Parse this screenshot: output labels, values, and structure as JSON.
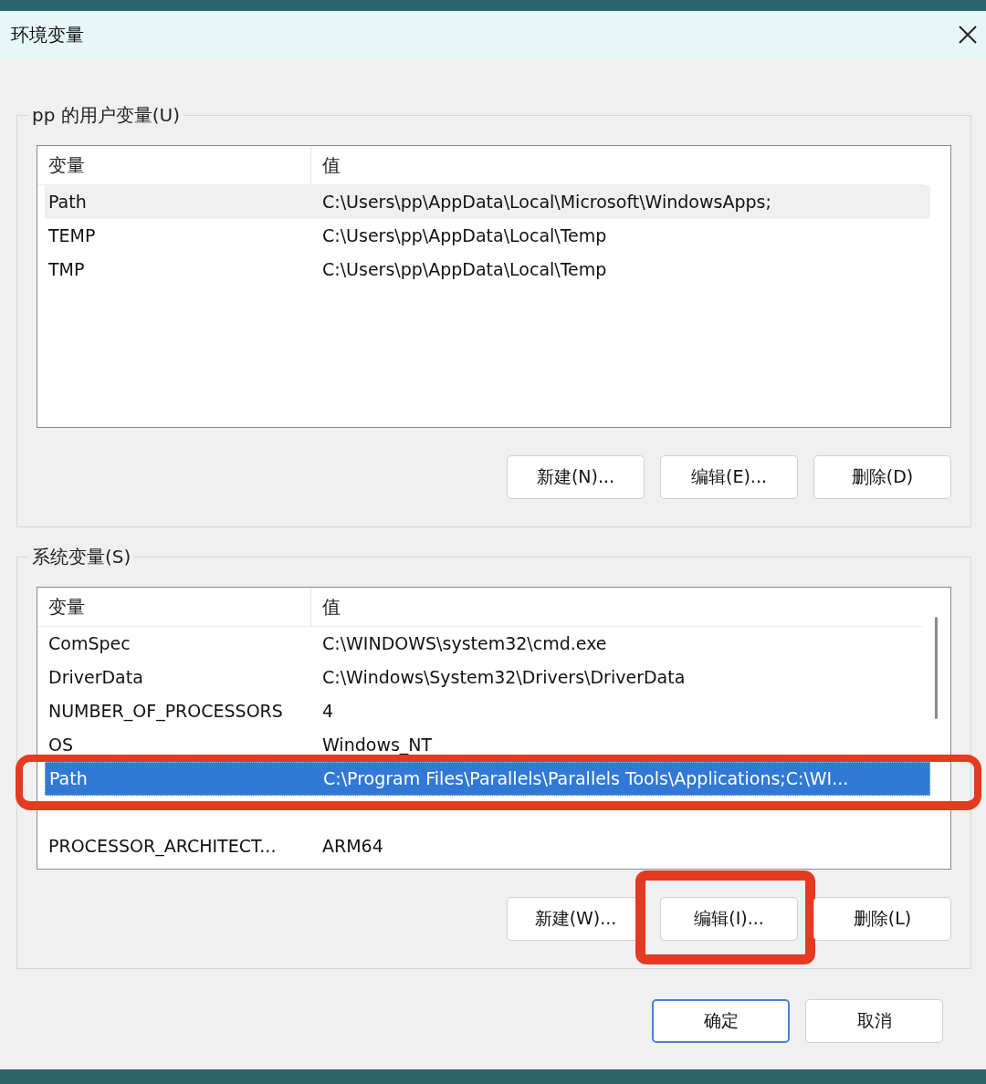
{
  "window": {
    "title": "环境变量"
  },
  "groups": [
    {
      "label": "pp 的用户变量(U)",
      "focused": false,
      "scrollbar": false,
      "columns": [
        "变量",
        "值"
      ],
      "rows": [
        {
          "name": "Path",
          "value": "C:\\Users\\pp\\AppData\\Local\\Microsoft\\WindowsApps;",
          "selected": true,
          "annotated": false
        },
        {
          "name": "TEMP",
          "value": "C:\\Users\\pp\\AppData\\Local\\Temp",
          "selected": false,
          "annotated": false
        },
        {
          "name": "TMP",
          "value": "C:\\Users\\pp\\AppData\\Local\\Temp",
          "selected": false,
          "annotated": false
        }
      ],
      "buttons": [
        {
          "label": "新建(N)...",
          "annotated": false
        },
        {
          "label": "编辑(E)...",
          "annotated": false
        },
        {
          "label": "删除(D)",
          "annotated": false
        }
      ]
    },
    {
      "label": "系统变量(S)",
      "focused": true,
      "scrollbar": true,
      "columns": [
        "变量",
        "值"
      ],
      "rows": [
        {
          "name": "ComSpec",
          "value": "C:\\WINDOWS\\system32\\cmd.exe",
          "selected": false,
          "annotated": false
        },
        {
          "name": "DriverData",
          "value": "C:\\Windows\\System32\\Drivers\\DriverData",
          "selected": false,
          "annotated": false
        },
        {
          "name": "NUMBER_OF_PROCESSORS",
          "value": "4",
          "selected": false,
          "annotated": false
        },
        {
          "name": "OS",
          "value": "Windows_NT",
          "selected": false,
          "annotated": false
        },
        {
          "name": "Path",
          "value": "C:\\Program Files\\Parallels\\Parallels Tools\\Applications;C:\\WI...",
          "selected": true,
          "annotated": true
        },
        {
          "name": "PROCESSOR_ARCHITECT...",
          "value": "ARM64",
          "selected": false,
          "annotated": false
        }
      ],
      "buttons": [
        {
          "label": "新建(W)...",
          "annotated": false
        },
        {
          "label": "编辑(I)...",
          "annotated": true
        },
        {
          "label": "删除(L)",
          "annotated": false
        }
      ]
    }
  ],
  "dialog_buttons": [
    {
      "label": "确定",
      "default": true
    },
    {
      "label": "取消",
      "default": false
    }
  ]
}
